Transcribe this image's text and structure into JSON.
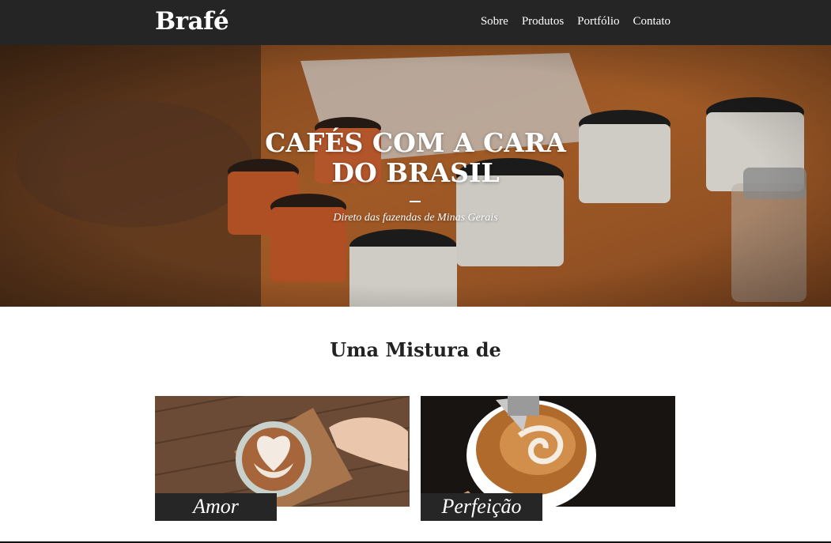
{
  "header": {
    "logo": "Brafé",
    "nav": [
      "Sobre",
      "Produtos",
      "Portfólio",
      "Contato"
    ]
  },
  "hero": {
    "title_line1": "CAFÉS COM A CARA",
    "title_line2": "DO BRASIL",
    "subtitle": "Direto das fazendas de Minas Gerais"
  },
  "section": {
    "title": "Uma Mistura de",
    "cards": [
      {
        "label": "Amor"
      },
      {
        "label": "Perfeição"
      }
    ]
  },
  "colors": {
    "header_bg": "#252525",
    "label_bg": "#262626",
    "text_dark": "#222222"
  }
}
